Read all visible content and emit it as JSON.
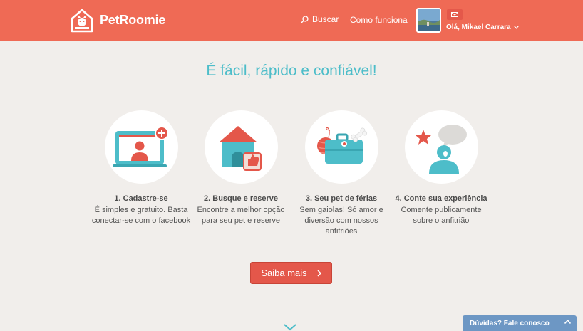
{
  "header": {
    "brand": "PetRoomie",
    "nav": {
      "search_label": "Buscar",
      "how_label": "Como funciona"
    },
    "user": {
      "greeting": "Olá, Mikael Carrara"
    }
  },
  "main": {
    "tagline": "É fácil, rápido e confiável!",
    "steps": [
      {
        "title": "1. Cadastre-se",
        "description": "É simples e gratuito. Basta conectar-se com o facebook",
        "icon": "laptop-signup-icon"
      },
      {
        "title": "2. Busque e reserve",
        "description": "Encontre a melhor opção para seu pet e reserve",
        "icon": "doghouse-thumbs-up-icon"
      },
      {
        "title": "3. Seu pet de férias",
        "description": "Sem gaiolas! Só amor e diversão com nossos anfitriões",
        "icon": "suitcase-icon"
      },
      {
        "title": "4. Conte sua experiência",
        "description": "Comente publicamente sobre o anfitrião",
        "icon": "review-speech-icon"
      }
    ],
    "cta_label": "Saiba mais"
  },
  "help_widget": {
    "label": "Dúvidas? Fale conosco"
  },
  "colors": {
    "header": "#ef6a55",
    "accent_teal": "#4dbdc9",
    "cta": "#e4574a",
    "help": "#6d97c4",
    "background": "#f1eeeb"
  }
}
